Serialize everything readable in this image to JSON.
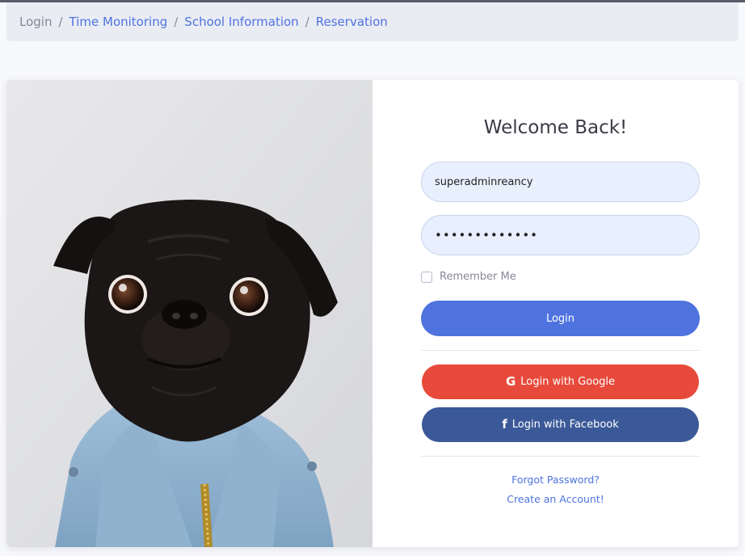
{
  "breadcrumb": {
    "items": [
      {
        "label": "Login",
        "active": true
      },
      {
        "label": "Time Monitoring",
        "active": false
      },
      {
        "label": "School Information",
        "active": false
      },
      {
        "label": "Reservation",
        "active": false
      }
    ],
    "separator": "/"
  },
  "login_card": {
    "title": "Welcome Back!",
    "username_value": "superadminreancy",
    "password_masked": "•••••••••••••",
    "remember_label": "Remember Me",
    "remember_checked": false,
    "login_button": "Login",
    "google_button": "Login with Google",
    "facebook_button": "Login with Facebook",
    "google_icon": "G",
    "facebook_icon": "f",
    "forgot_link": "Forgot Password?",
    "create_link": "Create an Account!"
  },
  "colors": {
    "primary": "#4e73df",
    "google": "#e74a3b",
    "facebook": "#3b5998",
    "breadcrumb_bg": "#eaecf4"
  },
  "image": {
    "subject": "pug-in-denim-jacket-photo"
  }
}
